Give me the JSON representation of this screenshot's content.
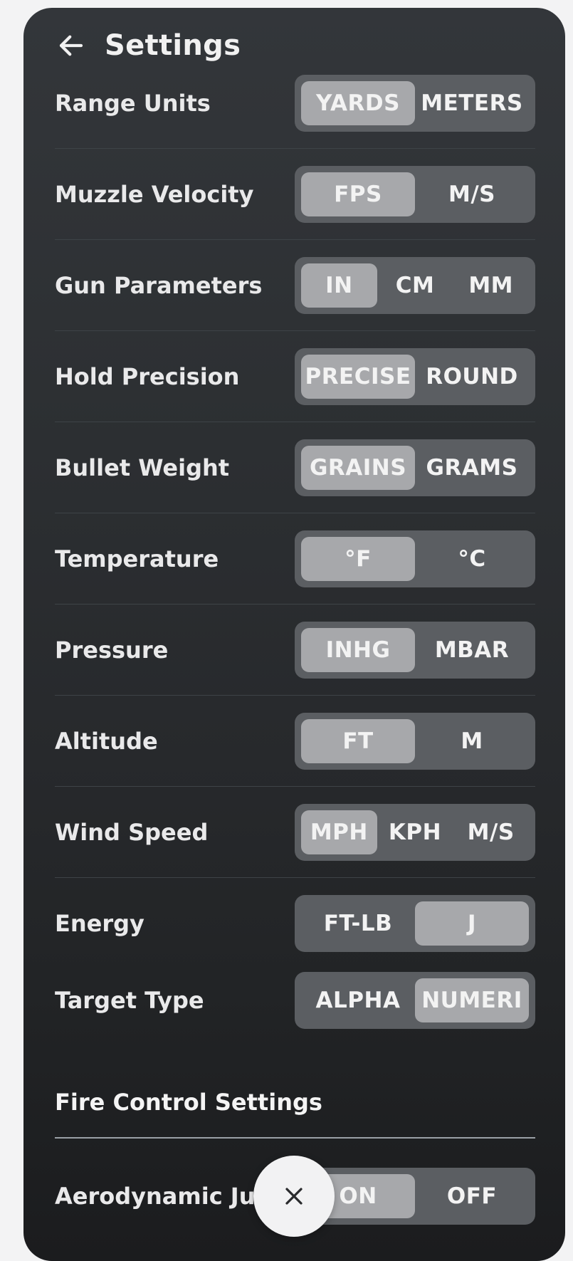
{
  "header": {
    "title": "Settings"
  },
  "rows": [
    {
      "label": "Range Units",
      "options": [
        "YARDS",
        "METERS"
      ],
      "active": 0
    },
    {
      "label": "Muzzle Velocity",
      "options": [
        "FPS",
        "M/S"
      ],
      "active": 0
    },
    {
      "label": "Gun Parameters",
      "options": [
        "IN",
        "CM",
        "MM"
      ],
      "active": 0
    },
    {
      "label": "Hold Precision",
      "options": [
        "PRECISE",
        "ROUND"
      ],
      "active": 0
    },
    {
      "label": "Bullet Weight",
      "options": [
        "GRAINS",
        "GRAMS"
      ],
      "active": 0
    },
    {
      "label": "Temperature",
      "options": [
        "°F",
        "°C"
      ],
      "active": 0
    },
    {
      "label": "Pressure",
      "options": [
        "INHG",
        "MBAR"
      ],
      "active": 0
    },
    {
      "label": "Altitude",
      "options": [
        "FT",
        "M"
      ],
      "active": 0
    },
    {
      "label": "Wind Speed",
      "options": [
        "MPH",
        "KPH",
        "M/S"
      ],
      "active": 0
    },
    {
      "label": "Energy",
      "options": [
        "FT-LB",
        "J"
      ],
      "active": 1
    },
    {
      "label": "Target Type",
      "options": [
        "ALPHA",
        "NUMERI"
      ],
      "active": 1
    }
  ],
  "fire_control": {
    "title": "Fire Control Settings",
    "rows": [
      {
        "label": "Aerodynamic Jum",
        "options": [
          "ON",
          "OFF"
        ],
        "active": 0
      }
    ]
  },
  "icons": {
    "back": "arrow-left-icon",
    "close": "close-icon"
  },
  "colors": {
    "panel_bg": "#2c2f32",
    "segment_bg": "#5b5e62",
    "segment_active": "#a7a8ab",
    "text": "#e9e9ea"
  }
}
